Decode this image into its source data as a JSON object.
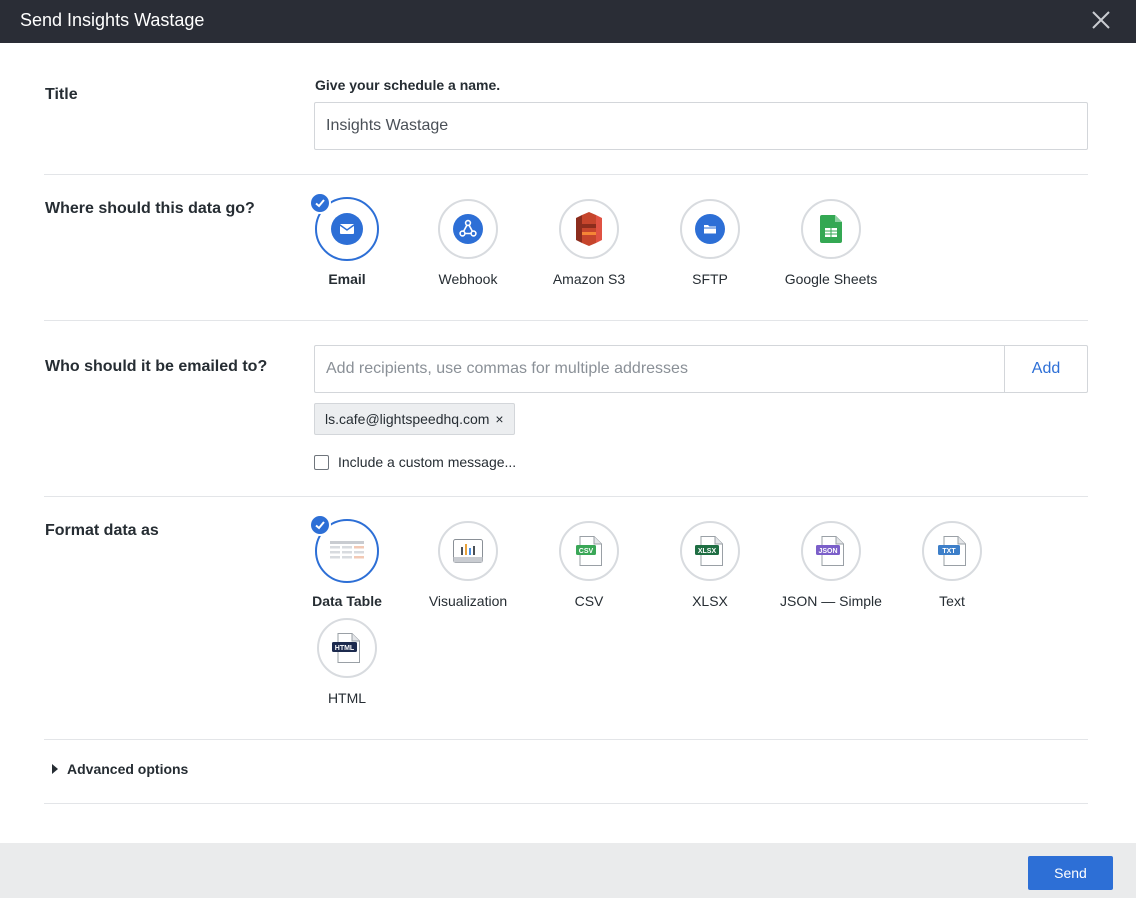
{
  "dialog": {
    "title": "Send Insights Wastage"
  },
  "title_section": {
    "label": "Title",
    "hint": "Give your schedule a name.",
    "value": "Insights Wastage"
  },
  "destination_section": {
    "label": "Where should this data go?",
    "options": [
      {
        "label": "Email",
        "icon": "email-icon",
        "selected": true
      },
      {
        "label": "Webhook",
        "icon": "webhook-icon",
        "selected": false
      },
      {
        "label": "Amazon S3",
        "icon": "amazon-s3-icon",
        "selected": false
      },
      {
        "label": "SFTP",
        "icon": "sftp-folder-icon",
        "selected": false
      },
      {
        "label": "Google Sheets",
        "icon": "google-sheets-icon",
        "selected": false
      }
    ]
  },
  "recipients_section": {
    "label": "Who should it be emailed to?",
    "placeholder": "Add recipients, use commas for multiple addresses",
    "add_label": "Add",
    "recipients": [
      "ls.cafe@lightspeedhq.com"
    ],
    "remove_symbol": "×",
    "custom_message_label": "Include a custom message..."
  },
  "format_section": {
    "label": "Format data as",
    "options": [
      {
        "label": "Data Table",
        "icon": "data-table-icon",
        "selected": true
      },
      {
        "label": "Visualization",
        "icon": "visualization-icon",
        "selected": false
      },
      {
        "label": "CSV",
        "icon": "csv-file-icon",
        "badge": "CSV",
        "selected": false
      },
      {
        "label": "XLSX",
        "icon": "xlsx-file-icon",
        "badge": "XLSX",
        "selected": false
      },
      {
        "label": "JSON — Simple",
        "icon": "json-file-icon",
        "badge": "JSON",
        "selected": false
      },
      {
        "label": "Text",
        "icon": "text-file-icon",
        "badge": "TXT",
        "selected": false
      },
      {
        "label": "HTML",
        "icon": "html-file-icon",
        "badge": "HTML",
        "selected": false
      }
    ]
  },
  "advanced": {
    "label": "Advanced options"
  },
  "footer": {
    "send_label": "Send"
  },
  "colors": {
    "accent": "#2d6fd6",
    "titlebar": "#2a2d36",
    "s3_red": "#c6452c",
    "sheets_green": "#34a853",
    "csv_green": "#3aa757",
    "xlsx_green": "#1f6e43",
    "json_purple": "#7b5fc9",
    "txt_blue": "#3d7fc9",
    "html_navy": "#1c2a4e"
  }
}
